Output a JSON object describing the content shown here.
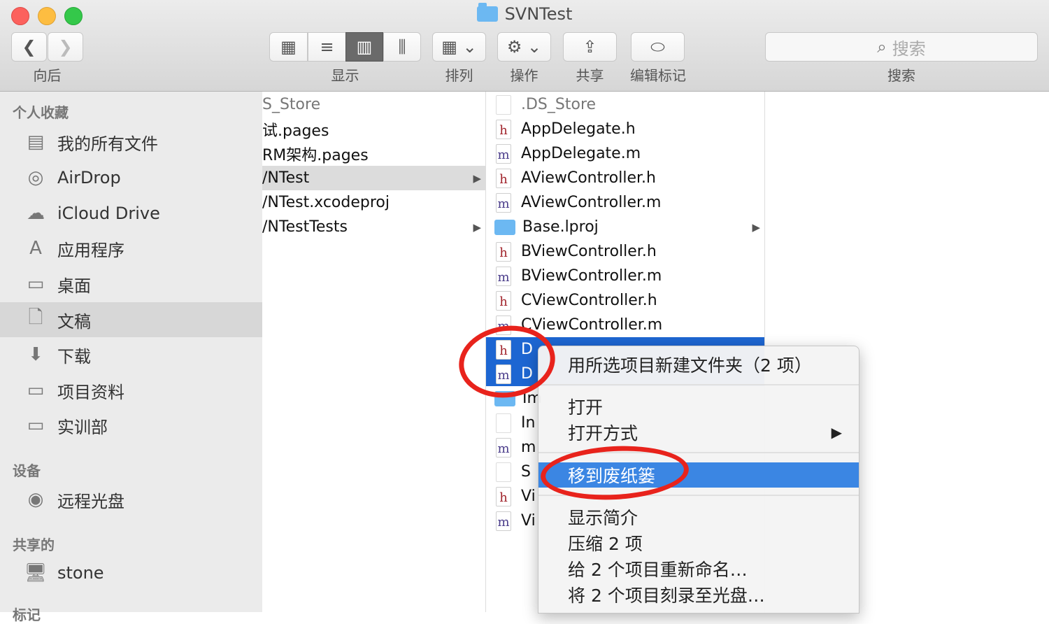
{
  "window": {
    "title": "SVNTest"
  },
  "toolbar": {
    "back_label": "向后",
    "view_label": "显示",
    "arrange_label": "排列",
    "action_label": "操作",
    "share_label": "共享",
    "tags_label": "编辑标记",
    "search_placeholder": "搜索",
    "search_label": "搜索"
  },
  "sidebar": {
    "favorites_header": "个人收藏",
    "favorites": [
      "我的所有文件",
      "AirDrop",
      "iCloud Drive",
      "应用程序",
      "桌面",
      "文稿",
      "下载",
      "项目资料",
      "实训部"
    ],
    "devices_header": "设备",
    "devices": [
      "远程光盘"
    ],
    "shared_header": "共享的",
    "shared": [
      "stone"
    ],
    "tags_header": "标记"
  },
  "column1": {
    "items": [
      "S_Store",
      "试.pages",
      "RM架构.pages",
      "/NTest",
      "/NTest.xcodeproj",
      "/NTestTests"
    ]
  },
  "column2": {
    "items": [
      {
        "name": ".DS_Store",
        "icon": "blank"
      },
      {
        "name": "AppDelegate.h",
        "icon": "h"
      },
      {
        "name": "AppDelegate.m",
        "icon": "m"
      },
      {
        "name": "AViewController.h",
        "icon": "h"
      },
      {
        "name": "AViewController.m",
        "icon": "m"
      },
      {
        "name": "Base.lproj",
        "icon": "folder"
      },
      {
        "name": "BViewController.h",
        "icon": "h"
      },
      {
        "name": "BViewController.m",
        "icon": "m"
      },
      {
        "name": "CViewController.h",
        "icon": "h"
      },
      {
        "name": "CViewController.m",
        "icon": "m"
      },
      {
        "name": "D",
        "icon": "h"
      },
      {
        "name": "D",
        "icon": "m"
      },
      {
        "name": "Im",
        "icon": "folder"
      },
      {
        "name": "In",
        "icon": "plist"
      },
      {
        "name": "m",
        "icon": "m"
      },
      {
        "name": "S",
        "icon": "storyboard"
      },
      {
        "name": "Vi",
        "icon": "h"
      },
      {
        "name": "Vi",
        "icon": "m"
      }
    ]
  },
  "context_menu": {
    "new_folder": "用所选项目新建文件夹（2 项）",
    "open": "打开",
    "open_with": "打开方式",
    "move_to_trash": "移到废纸篓",
    "get_info": "显示简介",
    "compress": "压缩 2 项",
    "rename": "给 2 个项目重新命名…",
    "burn": "将 2 个项目刻录至光盘…"
  }
}
